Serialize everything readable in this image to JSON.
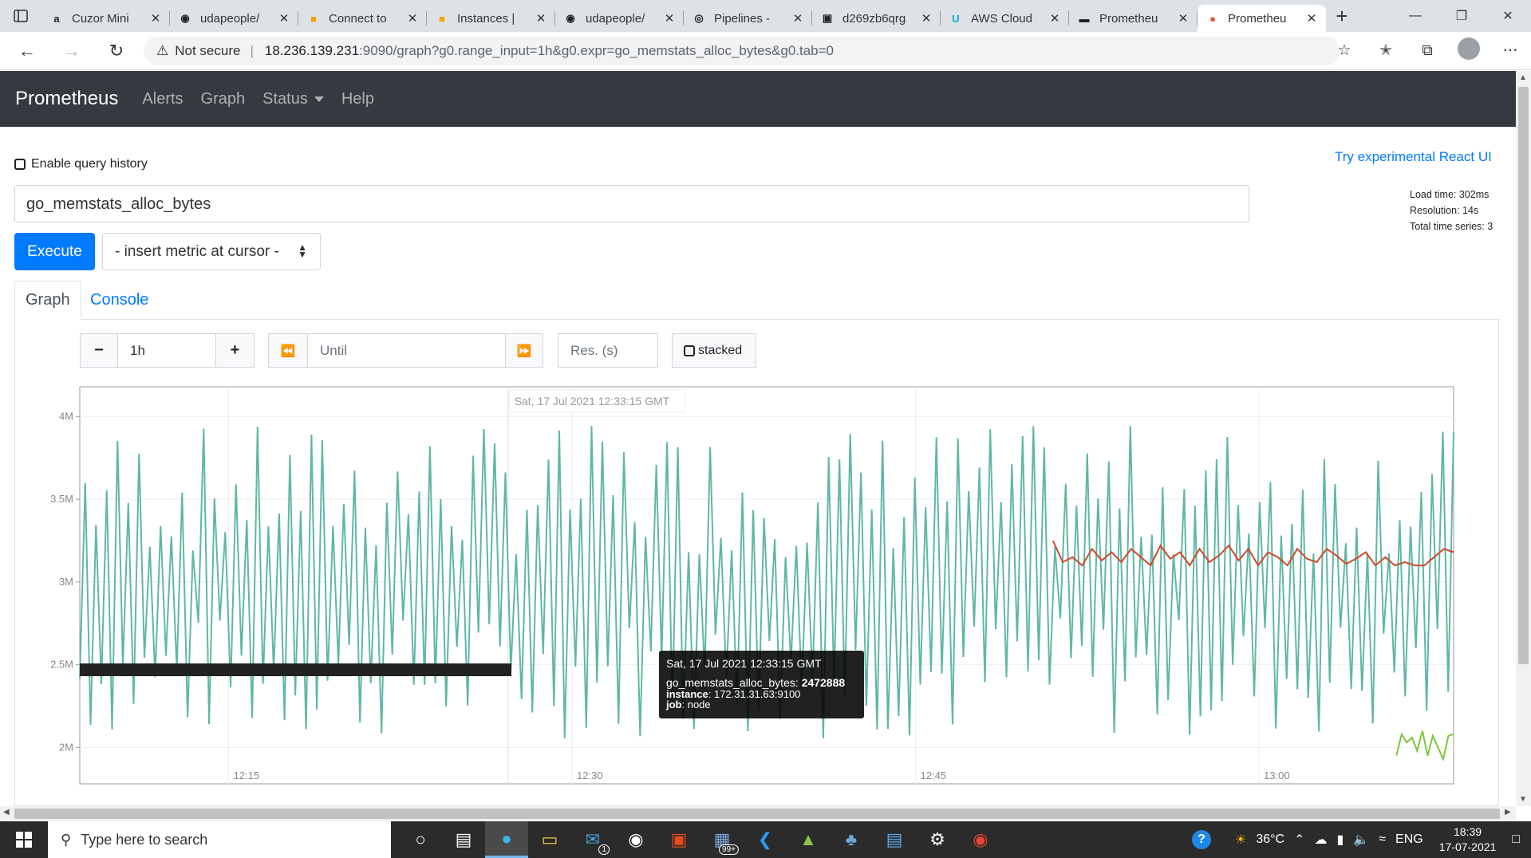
{
  "browser": {
    "tabs": [
      {
        "label": "Cuzor Mini",
        "icon": "amazon-icon"
      },
      {
        "label": "udapeople/",
        "icon": "github-icon"
      },
      {
        "label": "Connect to",
        "icon": "aws-box-icon"
      },
      {
        "label": "Instances | ",
        "icon": "aws-box-icon"
      },
      {
        "label": "udapeople/",
        "icon": "github-icon"
      },
      {
        "label": "Pipelines - ",
        "icon": "circleci-icon"
      },
      {
        "label": "d269zb6qrg",
        "icon": "page-icon"
      },
      {
        "label": "AWS Cloud",
        "icon": "udacity-icon"
      },
      {
        "label": "Prometheu",
        "icon": "terminal-icon"
      },
      {
        "label": "Prometheu",
        "icon": "prometheus-icon"
      }
    ],
    "address": {
      "security": "Not secure",
      "host": "18.236.139.231",
      "path": ":9090/graph?g0.range_input=1h&g0.expr=go_memstats_alloc_bytes&g0.tab=0"
    }
  },
  "nav": {
    "brand": "Prometheus",
    "links": [
      "Alerts",
      "Graph",
      "Status",
      "Help"
    ]
  },
  "page": {
    "query_history_label": "Enable query history",
    "react_link": "Try experimental React UI",
    "stats": [
      "Load time: 302ms",
      "Resolution: 14s",
      "Total time series: 3"
    ],
    "expression": "go_memstats_alloc_bytes",
    "execute_label": "Execute",
    "metric_select": "- insert metric at cursor -",
    "tabs": [
      "Graph",
      "Console"
    ],
    "controls": {
      "minus": "−",
      "range": "1h",
      "plus": "+",
      "back": "⏪",
      "until_placeholder": "Until",
      "forward": "⏩",
      "res_placeholder": "Res. (s)",
      "stacked": "stacked"
    }
  },
  "tooltip": {
    "time": "Sat, 17 Jul 2021 12:33:15 GMT",
    "metric_key": "go_memstats_alloc_bytes:",
    "metric_value": "2472888",
    "instance_key": "instance",
    "instance_value": ": 172.31.31.63:9100",
    "job_key": "job",
    "job_value": ": node"
  },
  "chart_data": {
    "type": "line",
    "hover_label": "Sat, 17 Jul 2021 12:33:15 GMT",
    "x_ticks": [
      "12:15",
      "12:30",
      "12:45",
      "13:00"
    ],
    "y_ticks": [
      "4M",
      "3.5M",
      "3M",
      "2.5M",
      "2M"
    ],
    "ylim": [
      1.78,
      4.18
    ],
    "ylabel_unit": "M",
    "grid": true,
    "series": [
      {
        "color": "#5fb7a6",
        "start_min": 0,
        "end_min": 60,
        "values_note": "oscillating between 1.95 and 3.95",
        "low": 1.95,
        "high": 3.95
      },
      {
        "color": "#cc4b2c",
        "start_min": 42.5,
        "end_min": 60,
        "values": [
          3.25,
          3.12,
          3.15,
          3.1,
          3.2,
          3.13,
          3.18,
          3.12,
          3.2,
          3.15,
          3.1,
          3.22,
          3.14,
          3.18,
          3.1,
          3.2,
          3.12,
          3.16,
          3.22,
          3.13,
          3.2,
          3.1,
          3.18,
          3.15,
          3.1,
          3.2,
          3.14,
          3.12,
          3.2,
          3.16,
          3.11,
          3.14,
          3.18,
          3.1,
          3.15,
          3.1,
          3.12,
          3.1,
          3.1,
          3.15,
          3.2,
          3.18
        ]
      },
      {
        "color": "#7ec63b",
        "start_min": 57.5,
        "end_min": 60,
        "values": [
          1.95,
          2.08,
          2.03,
          2.06,
          1.98,
          2.1,
          1.95,
          2.07,
          2.0,
          1.93,
          2.07,
          2.08
        ]
      }
    ]
  }
}
